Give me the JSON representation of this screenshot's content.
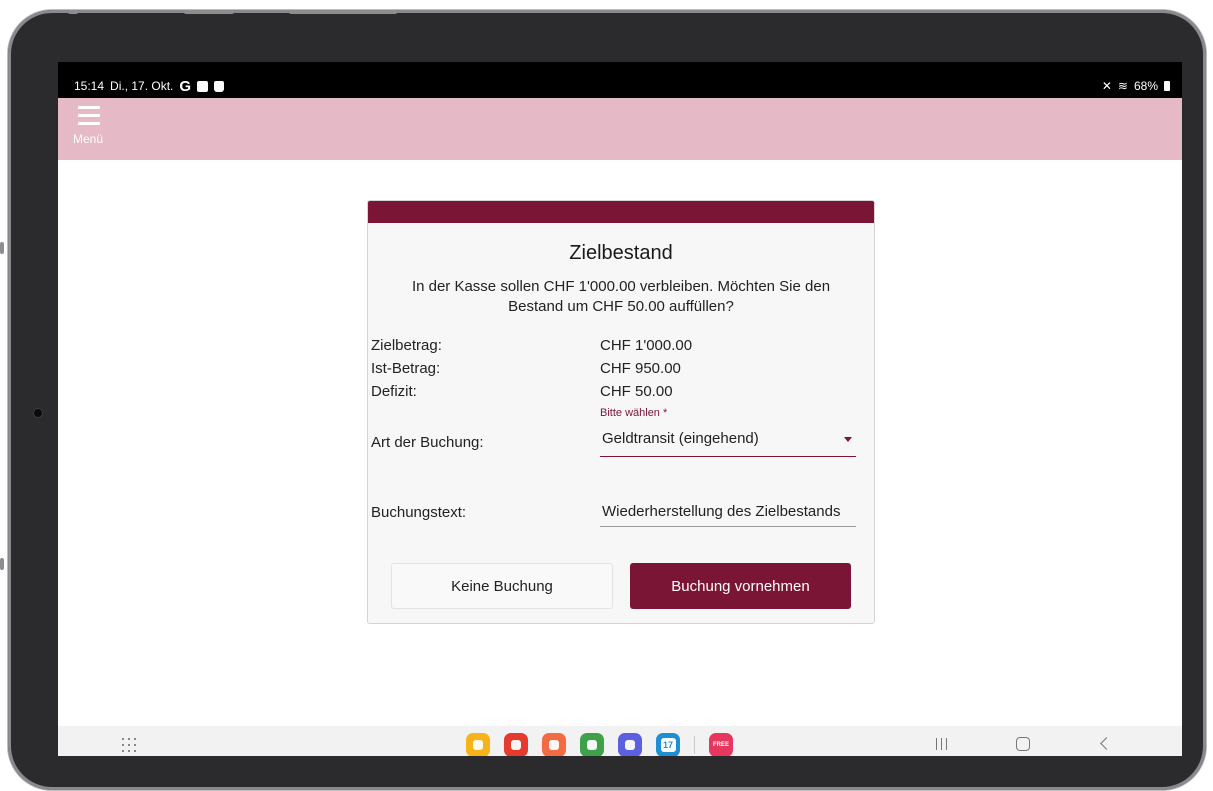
{
  "status_bar": {
    "time": "15:14",
    "date": "Di., 17. Okt.",
    "left_icons": [
      "google-icon",
      "gallery-icon",
      "shopping-bag-icon"
    ],
    "battery": "68%",
    "right_icons": [
      "mute-icon",
      "wifi-icon",
      "battery-icon"
    ]
  },
  "header": {
    "menu_label": "Menü",
    "background": "#e5b9c6"
  },
  "dialog": {
    "accent": "#7b1535",
    "title": "Zielbestand",
    "message": "In der Kasse sollen CHF 1'000.00 verbleiben. Möchten Sie den Bestand um CHF 50.00 auffüllen?",
    "rows": [
      {
        "label": "Zielbetrag:",
        "value": "CHF 1'000.00"
      },
      {
        "label": "Ist-Betrag:",
        "value": "CHF 950.00"
      },
      {
        "label": "Defizit:",
        "value": "CHF 50.00"
      }
    ],
    "booking_type": {
      "label": "Art der Buchung:",
      "hint": "Bitte wählen *",
      "value": "Geldtransit (eingehend)"
    },
    "booking_text": {
      "label": "Buchungstext:",
      "value": "Wiederherstellung des Zielbestands"
    },
    "buttons": {
      "cancel": "Keine Buchung",
      "confirm": "Buchung vornehmen"
    }
  },
  "nav_bar": {
    "dock_apps": [
      {
        "name": "my-files-icon",
        "color": "#f7b418"
      },
      {
        "name": "samsung-notes-icon",
        "color": "#e53b2f"
      },
      {
        "name": "contacts-icon",
        "color": "#f36b45"
      },
      {
        "name": "calculator-icon",
        "color": "#3fa14a"
      },
      {
        "name": "internet-icon",
        "color": "#5b5fe0"
      },
      {
        "name": "calendar-icon",
        "color": "#1e8fd3",
        "label": "17"
      },
      {
        "name": "free-app-icon",
        "color": "#e8375e",
        "label": "FREE"
      }
    ]
  }
}
